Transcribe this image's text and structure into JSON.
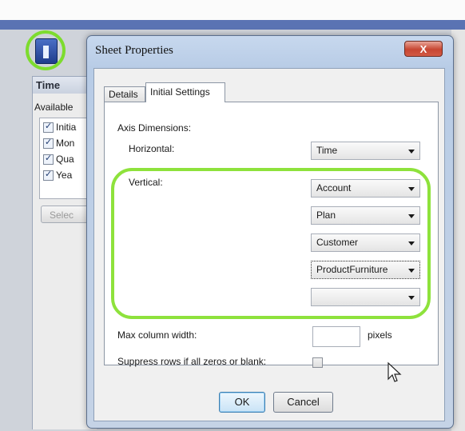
{
  "background": {
    "panel_header": "Time",
    "available_label": "Available",
    "checks": [
      "Initia",
      "Mon",
      "Qua",
      "Yea"
    ],
    "select_button": "Selec"
  },
  "dialog": {
    "title": "Sheet Properties",
    "close_label": "X",
    "tabs": [
      {
        "label": "Details",
        "selected": false
      },
      {
        "label": "Initial Settings",
        "selected": true
      }
    ],
    "axis_dimensions_label": "Axis Dimensions:",
    "horizontal_label": "Horizontal:",
    "horizontal_value": "Time",
    "vertical_label": "Vertical:",
    "vertical_values": [
      "Account",
      "Plan",
      "Customer",
      "ProductFurniture",
      ""
    ],
    "max_column_width_label": "Max column width:",
    "max_column_width_value": "",
    "pixels_label": "pixels",
    "suppress_label": "Suppress rows if all zeros or blank:",
    "suppress_checked": false,
    "ok_label": "OK",
    "cancel_label": "Cancel"
  },
  "colors": {
    "highlight": "#8ee23c",
    "title_bar": "#b8cce6",
    "close_button": "#c74632"
  }
}
